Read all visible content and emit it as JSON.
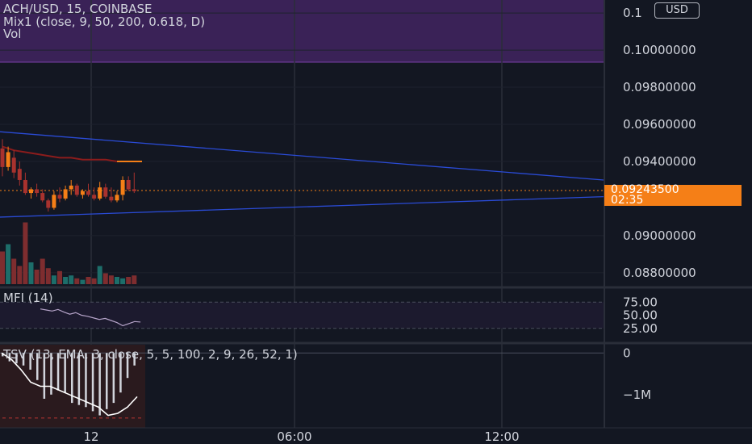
{
  "header": {
    "symbol_title": "ACH/USD, 15, COINBASE",
    "mix_indicator": "Mix1 (close, 9, 50, 200, 0.618, D)",
    "volume_label": "Vol",
    "currency_button": "USD"
  },
  "last_price": {
    "value": "0.09243500",
    "countdown": "02:35"
  },
  "colors": {
    "background": "#131722",
    "up": "#f57f17",
    "down": "#a8322e",
    "volume_up": "#1d6e6a",
    "volume_down": "#7e2d2f",
    "trendline": "#2a4bd6",
    "ma_line": "#8c1c1c",
    "purple_zone": "#3a2257",
    "mfi_line": "#b5a3c8",
    "tsv_histogram": "#d1d4dc",
    "tsv_line": "#ffffff",
    "price_tag": "#f57f17"
  },
  "chart_data": [
    {
      "type": "candlestick",
      "title": "ACH/USD, 15, COINBASE",
      "y_ticks": [
        "0.1",
        "0.10000000",
        "0.09800000",
        "0.09600000",
        "0.09400000",
        "0.09000000",
        "0.08800000"
      ],
      "y_tick_values": [
        0.102,
        0.1,
        0.098,
        0.096,
        0.094,
        0.09,
        0.088
      ],
      "ylim": [
        0.0873,
        0.1027
      ],
      "x_ticks": [
        "12",
        "06:00",
        "12:00"
      ],
      "last_price": 0.092435,
      "candles": [
        {
          "open": 0.0947,
          "high": 0.0952,
          "low": 0.0932,
          "close": 0.0937
        },
        {
          "open": 0.0937,
          "high": 0.0948,
          "low": 0.0935,
          "close": 0.0945
        },
        {
          "open": 0.0942,
          "high": 0.0946,
          "low": 0.0931,
          "close": 0.0934
        },
        {
          "open": 0.0936,
          "high": 0.094,
          "low": 0.0927,
          "close": 0.093
        },
        {
          "open": 0.093,
          "high": 0.0934,
          "low": 0.0922,
          "close": 0.0923
        },
        {
          "open": 0.0923,
          "high": 0.0926,
          "low": 0.092,
          "close": 0.0925
        },
        {
          "open": 0.0925,
          "high": 0.0928,
          "low": 0.0921,
          "close": 0.0923
        },
        {
          "open": 0.0923,
          "high": 0.0925,
          "low": 0.0918,
          "close": 0.0919
        },
        {
          "open": 0.0919,
          "high": 0.092,
          "low": 0.0913,
          "close": 0.0915
        },
        {
          "open": 0.0915,
          "high": 0.0924,
          "low": 0.0914,
          "close": 0.0922
        },
        {
          "open": 0.0922,
          "high": 0.0926,
          "low": 0.0918,
          "close": 0.092
        },
        {
          "open": 0.092,
          "high": 0.0927,
          "low": 0.0919,
          "close": 0.0925
        },
        {
          "open": 0.0925,
          "high": 0.093,
          "low": 0.0922,
          "close": 0.0927
        },
        {
          "open": 0.0927,
          "high": 0.0928,
          "low": 0.0921,
          "close": 0.0922
        },
        {
          "open": 0.0922,
          "high": 0.0925,
          "low": 0.092,
          "close": 0.0924
        },
        {
          "open": 0.0924,
          "high": 0.0928,
          "low": 0.0921,
          "close": 0.0922
        },
        {
          "open": 0.0922,
          "high": 0.0926,
          "low": 0.0919,
          "close": 0.092
        },
        {
          "open": 0.092,
          "high": 0.0929,
          "low": 0.0919,
          "close": 0.0926
        },
        {
          "open": 0.0926,
          "high": 0.0928,
          "low": 0.092,
          "close": 0.0921
        },
        {
          "open": 0.0921,
          "high": 0.0926,
          "low": 0.0918,
          "close": 0.0919
        },
        {
          "open": 0.0919,
          "high": 0.0924,
          "low": 0.0918,
          "close": 0.0922
        },
        {
          "open": 0.0922,
          "high": 0.0932,
          "low": 0.0919,
          "close": 0.093
        },
        {
          "open": 0.093,
          "high": 0.0932,
          "low": 0.0924,
          "close": 0.0925
        },
        {
          "open": 0.0925,
          "high": 0.0934,
          "low": 0.0923,
          "close": 0.0924
        }
      ],
      "volume": [
        0.45,
        0.55,
        0.35,
        0.25,
        0.85,
        0.3,
        0.2,
        0.35,
        0.22,
        0.12,
        0.18,
        0.1,
        0.12,
        0.08,
        0.06,
        0.1,
        0.08,
        0.25,
        0.15,
        0.12,
        0.1,
        0.08,
        0.1,
        0.12
      ],
      "ma_line": [
        0.0948,
        0.0946,
        0.0945,
        0.0944,
        0.0943,
        0.0942,
        0.0942,
        0.0941,
        0.0941,
        0.0941,
        0.094
      ],
      "trendlines": [
        {
          "from": [
            0,
            0.0956
          ],
          "to": [
            1,
            0.093
          ]
        },
        {
          "from": [
            0,
            0.091
          ],
          "to": [
            1,
            0.0921
          ]
        }
      ]
    },
    {
      "type": "line",
      "title": "MFI (14)",
      "y_ticks": [
        "75.00",
        "50.00",
        "25.00"
      ],
      "y_tick_values": [
        75,
        50,
        25
      ],
      "ylim": [
        0,
        100
      ],
      "series": [
        {
          "values": [
            62,
            60,
            58,
            61,
            56,
            52,
            55,
            50,
            48,
            45,
            42,
            44,
            40,
            36,
            30,
            34,
            38,
            37
          ]
        }
      ]
    },
    {
      "type": "bar",
      "title": "TSV (13, EMA, 3, close, 5, 5, 100, 2, 9, 26, 52, 1)",
      "y_ticks": [
        "0",
        "−1M"
      ],
      "y_tick_values": [
        0,
        -1000000
      ],
      "ylim": [
        -1800000,
        200000
      ],
      "histogram": [
        -80000,
        -200000,
        -250000,
        -300000,
        -400000,
        -650000,
        -1100000,
        -1000000,
        -900000,
        -950000,
        -1200000,
        -1250000,
        -1300000,
        -1400000,
        -1500000,
        -1350000,
        -1200000,
        -950000,
        -600000,
        -300000
      ],
      "line": [
        0,
        -150000,
        -400000,
        -700000,
        -800000,
        -800000,
        -900000,
        -1000000,
        -1100000,
        -1200000,
        -1300000,
        -1500000,
        -1450000,
        -1300000,
        -1050000
      ]
    }
  ]
}
